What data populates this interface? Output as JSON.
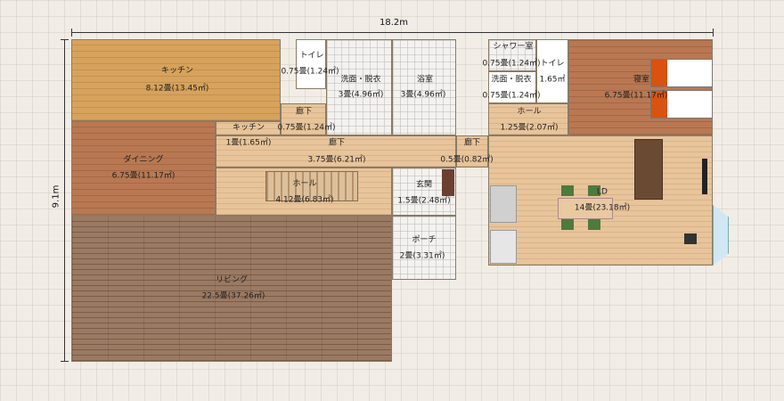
{
  "dimensions": {
    "width_label": "18.2m",
    "height_label": "9.1m"
  },
  "rooms": {
    "kitchen": {
      "name": "キッチン",
      "area": "8.12畳(13.45㎡)"
    },
    "toilet1": {
      "name": "トイレ",
      "area": "0.75畳(1.24㎡)"
    },
    "wash1": {
      "name": "洗面・脱衣",
      "area": "3畳(4.96㎡)"
    },
    "bath": {
      "name": "浴室",
      "area": "3畳(4.96㎡)"
    },
    "corridor1": {
      "name": "廊下",
      "area": "0.75畳(1.24㎡)"
    },
    "kitchen_small": {
      "name": "キッチン",
      "area": "1畳(1.65㎡)"
    },
    "dining": {
      "name": "ダイニング",
      "area": "6.75畳(11.17㎡)"
    },
    "corridor2": {
      "name": "廊下",
      "area": "3.75畳(6.21㎡)"
    },
    "corridor3": {
      "name": "廊下",
      "area": "0.5畳(0.82㎡)"
    },
    "hall1": {
      "name": "ホール",
      "area": "4.12畳(6.83㎡)"
    },
    "entrance": {
      "name": "玄関",
      "area": "1.5畳(2.48㎡)"
    },
    "porch": {
      "name": "ポーチ",
      "area": "2畳(3.31㎡)"
    },
    "living": {
      "name": "リビング",
      "area": "22.5畳(37.26㎡)"
    },
    "shower": {
      "name": "シャワー室",
      "area": "0.75畳(1.24㎡)"
    },
    "toilet2": {
      "name": "トイレ",
      "area": ""
    },
    "wash2": {
      "name": "洗面・脱衣",
      "area": "0.75畳(1.24㎡)"
    },
    "wash2_side": {
      "area": "1.65㎡"
    },
    "hall2": {
      "name": "ホール",
      "area": "1.25畳(2.07㎡)"
    },
    "bedroom": {
      "name": "寝室",
      "area": "6.75畳(11.17㎡)"
    },
    "ld": {
      "name": "LD",
      "area": "14畳(23.18㎡)"
    }
  }
}
